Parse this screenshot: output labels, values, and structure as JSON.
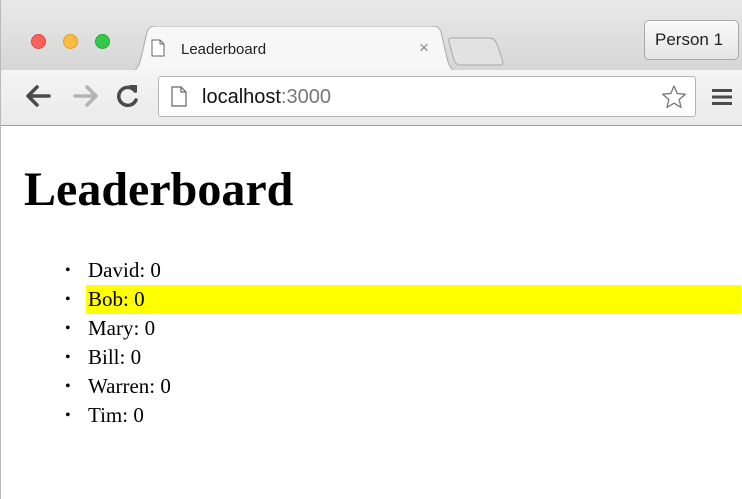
{
  "browser": {
    "tab_title": "Leaderboard",
    "tab_close": "×",
    "profile_label": "Person 1",
    "url_host": "localhost",
    "url_port": ":3000",
    "icons": {
      "back": "back-arrow-icon",
      "forward": "forward-arrow-icon",
      "reload": "reload-icon",
      "page": "page-icon",
      "bookmark": "star-icon",
      "menu": "hamburger-menu-icon"
    },
    "colors": {
      "close": "#fc605c",
      "minimize": "#fdbc40",
      "zoom": "#34c84a"
    }
  },
  "page": {
    "title": "Leaderboard",
    "bullet": "•",
    "players": [
      {
        "label": "David: 0",
        "selected": false
      },
      {
        "label": "Bob: 0",
        "selected": true
      },
      {
        "label": "Mary: 0",
        "selected": false
      },
      {
        "label": "Bill: 0",
        "selected": false
      },
      {
        "label": "Warren: 0",
        "selected": false
      },
      {
        "label": "Tim: 0",
        "selected": false
      }
    ],
    "highlight_color": "#ffff00"
  }
}
